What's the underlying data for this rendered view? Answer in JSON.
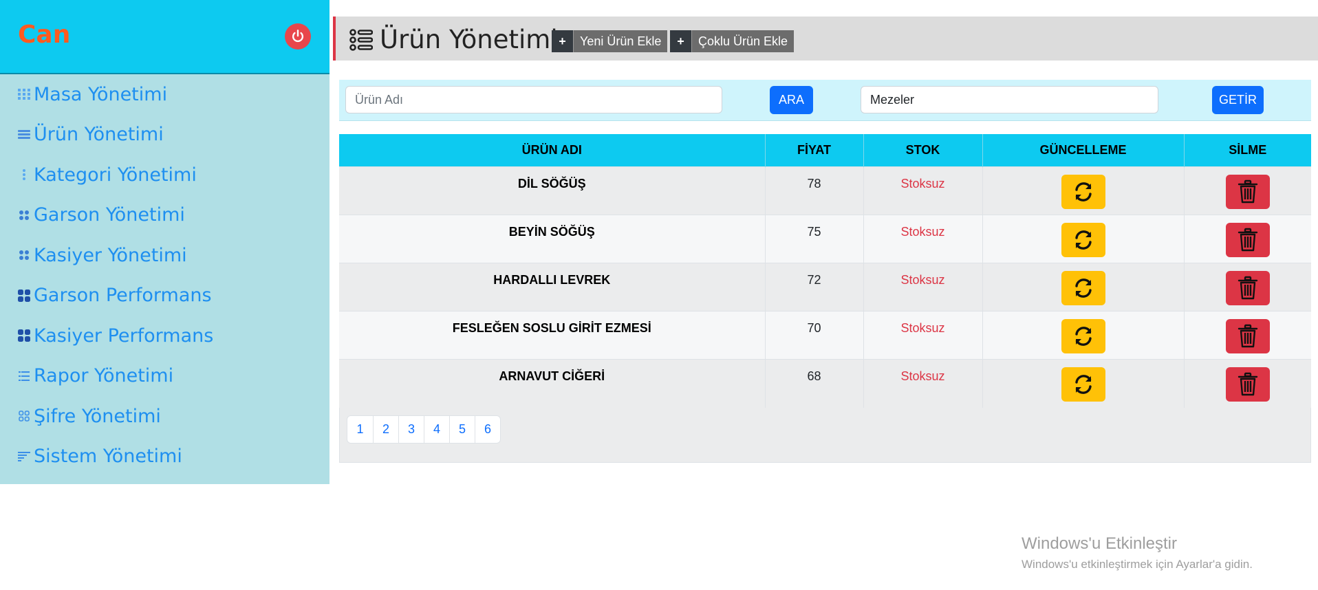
{
  "sidebar": {
    "brand": "Can",
    "items": [
      {
        "label": "Masa Yönetimi",
        "icon": "grid-icon"
      },
      {
        "label": "Ürün Yönetimi",
        "icon": "layers-icon"
      },
      {
        "label": "Kategori Yönetimi",
        "icon": "vertical-dots-icon"
      },
      {
        "label": "Garson Yönetimi",
        "icon": "four-dots-icon"
      },
      {
        "label": "Kasiyer Yönetimi",
        "icon": "four-dots-icon"
      },
      {
        "label": "Garson Performans",
        "icon": "four-squares-icon"
      },
      {
        "label": "Kasiyer Performans",
        "icon": "four-squares-icon"
      },
      {
        "label": "Rapor Yönetimi",
        "icon": "list-icon"
      },
      {
        "label": "Şifre Yönetimi",
        "icon": "four-squares-outline-icon"
      },
      {
        "label": "Sistem Yönetimi",
        "icon": "text-lines-icon"
      }
    ]
  },
  "header": {
    "title": "Ürün Yönetimi",
    "add_product_plus": "+",
    "add_product_label": "Yeni Ürün Ekle",
    "bulk_add_plus": "+",
    "bulk_add_label": "Çoklu Ürün Ekle"
  },
  "search": {
    "product_placeholder": "Ürün Adı",
    "search_button": "ARA",
    "category_value": "Mezeler",
    "fetch_button": "GETİR"
  },
  "table": {
    "headers": [
      "ÜRÜN ADI",
      "FİYAT",
      "STOK",
      "GÜNCELLEME",
      "SİLME"
    ],
    "rows": [
      {
        "name": "DİL SÖĞÜŞ",
        "price": "78",
        "stock": "Stoksuz"
      },
      {
        "name": "BEYİN SÖĞÜŞ",
        "price": "75",
        "stock": "Stoksuz"
      },
      {
        "name": "HARDALLI LEVREK",
        "price": "72",
        "stock": "Stoksuz"
      },
      {
        "name": "FESLEĞEN SOSLU GİRİT EZMESİ",
        "price": "70",
        "stock": "Stoksuz"
      },
      {
        "name": "ARNAVUT CİĞERİ",
        "price": "68",
        "stock": "Stoksuz"
      }
    ]
  },
  "pagination": [
    "1",
    "2",
    "3",
    "4",
    "5",
    "6"
  ],
  "watermark": {
    "title": "Windows'u Etkinleştir",
    "subtitle": "Windows'u etkinleştirmek için Ayarlar'a gidin."
  },
  "colors": {
    "sidebar_bg": "#b0dfe5",
    "accent_cyan": "#0dcaf0",
    "brand_orange": "#ff5a1f",
    "primary_blue": "#0d6efd",
    "warning_yellow": "#ffc107",
    "danger_red": "#dc3545"
  }
}
